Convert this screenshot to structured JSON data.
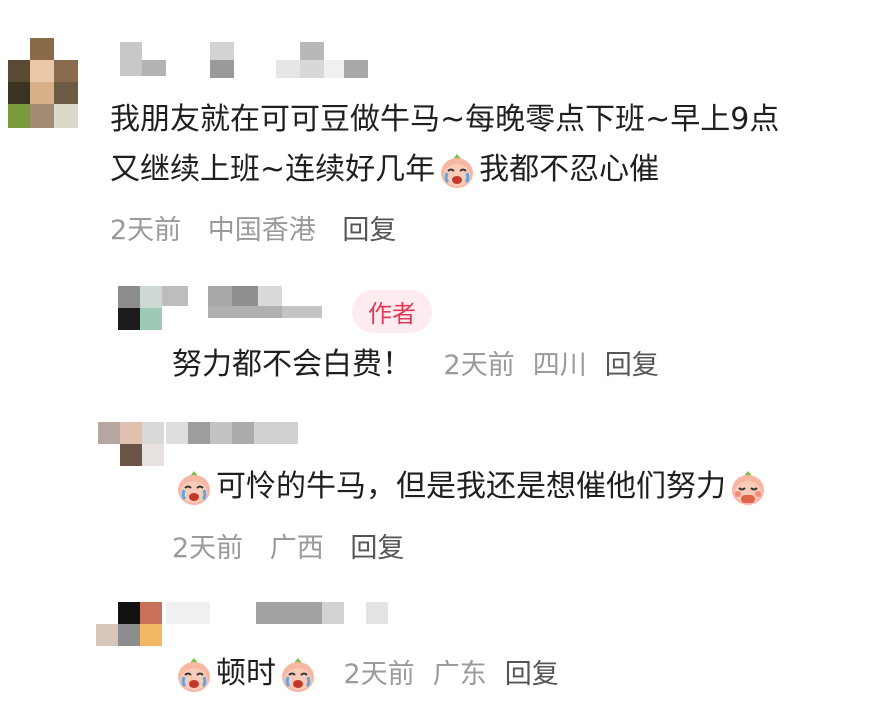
{
  "comments": [
    {
      "text_line1": "我朋友就在可可豆做牛马~每晚零点下班~早上9点",
      "text_line2_a": "又继续上班~连续好几年",
      "text_line2_b": "我都不忍心催",
      "time": "2天前",
      "location": "中国香港",
      "reply": "回复"
    },
    {
      "badge": "作者",
      "text": "努力都不会白费！",
      "time": "2天前",
      "location": "四川",
      "reply": "回复"
    },
    {
      "text_a": "可怜的牛马，但是我还是想催他们努力",
      "time": "2天前",
      "location": "广西",
      "reply": "回复"
    },
    {
      "text": "顿时",
      "time": "2天前",
      "location": "广东",
      "reply": "回复"
    }
  ],
  "icons": {
    "cry": "crying-peach-emoji",
    "shy": "shy-peach-emoji"
  },
  "colors": {
    "badge_bg": "#fdecef",
    "badge_text": "#e03a58",
    "meta": "#9a9a9a"
  }
}
